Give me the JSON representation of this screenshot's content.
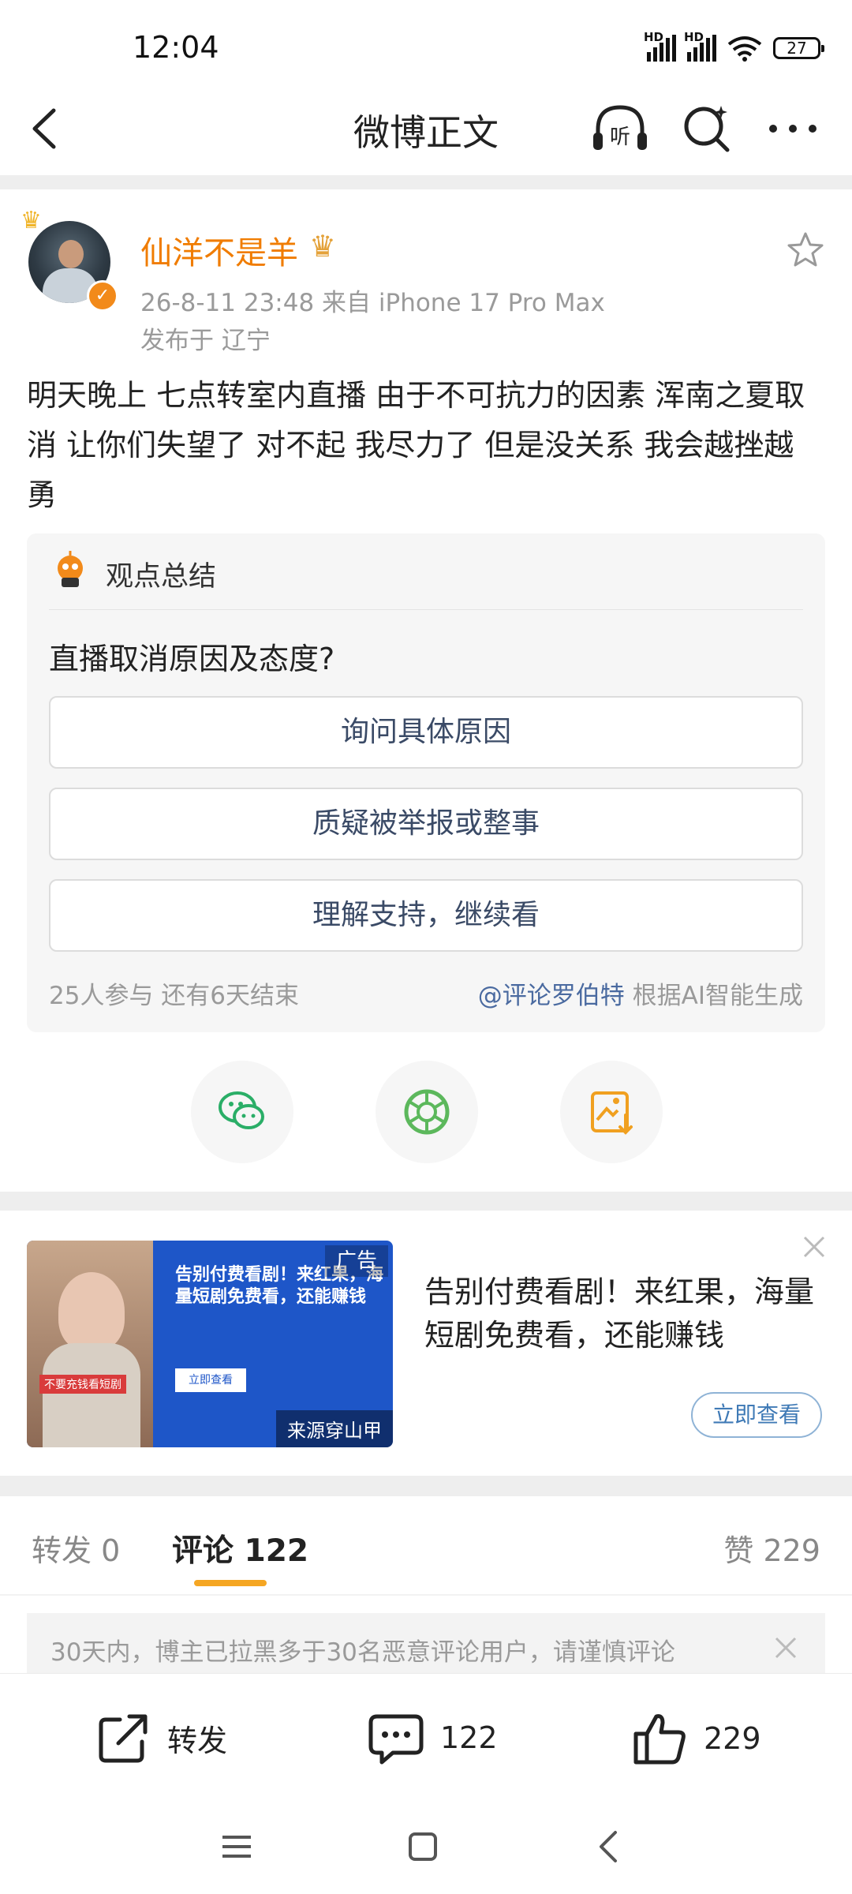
{
  "status_bar": {
    "time": "12:04",
    "signal_1_label": "HD",
    "signal_2_label": "HD",
    "battery": "27"
  },
  "header": {
    "title": "微博正文",
    "icons": [
      "back-icon",
      "listen-icon",
      "search-icon",
      "more-icon"
    ],
    "listen_icon_glyph": "听"
  },
  "post": {
    "username": "仙洋不是羊",
    "meta": "26-8-11 23:48   来自 iPhone 17 Pro Max",
    "location": "发布于 辽宁",
    "body": "明天晚上 七点转室内直播 由于不可抗力的因素 浑南之夏取消 让你们失望了 对不起 我尽力了 但是没关系 我会越挫越勇"
  },
  "opinion_card": {
    "title": "观点总结",
    "question": "直播取消原因及态度?",
    "options": [
      "询问具体原因",
      "质疑被举报或整事",
      "理解支持，继续看"
    ],
    "participation": "25人参与   还有6天结束",
    "mention": "@评论罗伯特",
    "generated_note": "根据AI智能生成"
  },
  "share_icons": [
    "wechat-icon",
    "moments-icon",
    "save-image-icon"
  ],
  "ad": {
    "image_headline": "告别付费看剧！来红果，海量短剧免费看，还能赚钱",
    "image_cta": "立即查看",
    "image_tagline": "不要充钱看短剧",
    "badge": "广告",
    "source": "来源穿山甲",
    "text": "告别付费看剧！来红果，海量短剧免费看，还能赚钱",
    "cta": "立即查看"
  },
  "tabs": {
    "repost": "转发 0",
    "comment": "评论 122",
    "like": "赞 229"
  },
  "notice": {
    "text": "30天内，博主已拉黑多于30名恶意评论用户，请谨慎评论"
  },
  "bottom_bar": {
    "repost_label": "转发",
    "comment_count": "122",
    "like_count": "229"
  },
  "colors": {
    "accent_orange": "#f07c00",
    "tab_indicator": "#f5a623",
    "link_blue": "#4a6aa0",
    "wechat_green": "#2aae67",
    "moments_green": "#5cb85c",
    "save_orange": "#f0a020"
  }
}
